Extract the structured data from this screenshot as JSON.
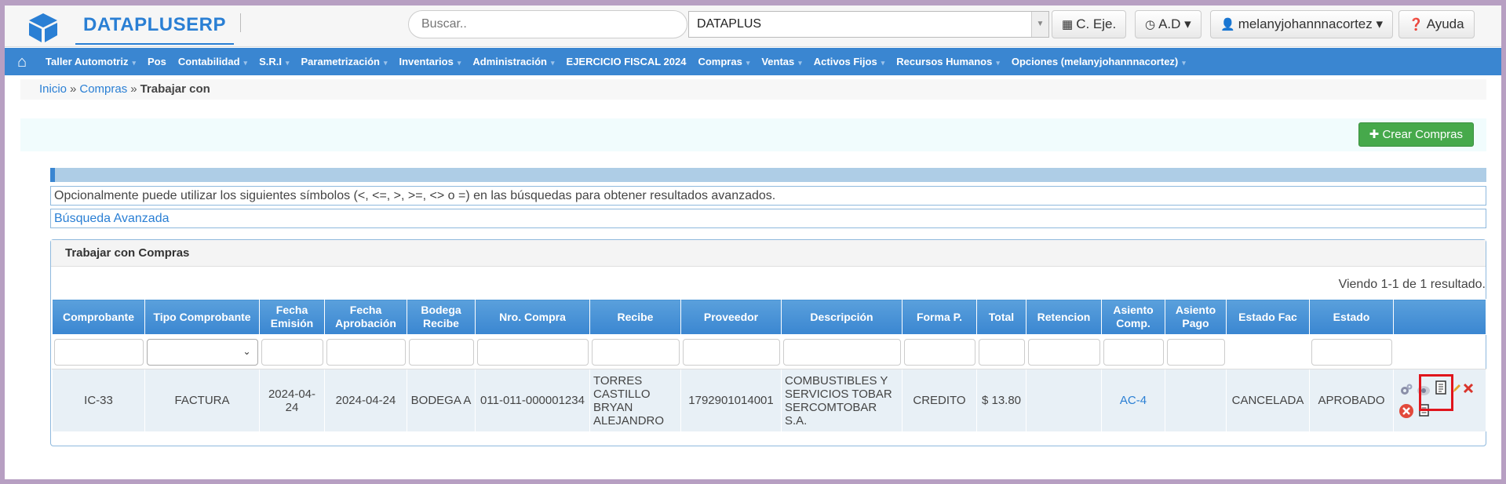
{
  "app": {
    "brand": "DATAPLUSERP",
    "search_placeholder": "Buscar..",
    "company": "DATAPLUS",
    "buttons": {
      "fiscal": "C. Eje.",
      "ad": "A.D",
      "user": "melanyjohannnacortez",
      "help": "Ayuda"
    }
  },
  "nav": {
    "items": [
      {
        "label": "Taller Automotriz",
        "caret": true
      },
      {
        "label": "Pos",
        "caret": false
      },
      {
        "label": "Contabilidad",
        "caret": true
      },
      {
        "label": "S.R.I",
        "caret": true
      },
      {
        "label": "Parametrización",
        "caret": true
      },
      {
        "label": "Inventarios",
        "caret": true
      },
      {
        "label": "Administración",
        "caret": true
      },
      {
        "label": "EJERCICIO FISCAL 2024",
        "caret": false
      },
      {
        "label": "Compras",
        "caret": true
      },
      {
        "label": "Ventas",
        "caret": true
      },
      {
        "label": "Activos Fijos",
        "caret": true
      },
      {
        "label": "Recursos Humanos",
        "caret": true
      },
      {
        "label": "Opciones (melanyjohannnacortez)",
        "caret": true
      }
    ]
  },
  "breadcrumb": {
    "home": "Inicio",
    "section": "Compras",
    "current": "Trabajar con",
    "separator": "»"
  },
  "actions": {
    "create": "Crear Compras"
  },
  "info": {
    "hint": "Opcionalmente puede utilizar los siguientes símbolos (<, <=, >, >=, <> o =) en las búsquedas para obtener resultados avanzados.",
    "advanced": "Búsqueda Avanzada"
  },
  "panel": {
    "title": "Trabajar con Compras",
    "summary": "Viendo 1-1 de 1 resultado."
  },
  "table": {
    "columns": [
      "Comprobante",
      "Tipo Comprobante",
      "Fecha Emisión",
      "Fecha Aprobación",
      "Bodega Recibe",
      "Nro. Compra",
      "Recibe",
      "Proveedor",
      "Descripción",
      "Forma P.",
      "Total",
      "Retencion",
      "Asiento Comp.",
      "Asiento Pago",
      "Estado Fac",
      "Estado",
      ""
    ],
    "rows": [
      {
        "comprobante": "IC-33",
        "tipo": "FACTURA",
        "fecha_emision": "2024-04-24",
        "fecha_aprobacion": "2024-04-24",
        "bodega": "BODEGA A",
        "nro_compra": "011-011-000001234",
        "recibe": "TORRES CASTILLO BRYAN ALEJANDRO",
        "proveedor": "1792901014001",
        "descripcion": "COMBUSTIBLES Y SERVICIOS TOBAR SERCOMTOBAR S.A.",
        "forma_pago": "CREDITO",
        "total": "$ 13.80",
        "retencion": "",
        "asiento_comp": "AC-4",
        "asiento_pago": "",
        "estado_fac": "CANCELADA",
        "estado": "APROBADO"
      }
    ]
  },
  "colors": {
    "brand": "#2a7fd4",
    "nav": "#3a86d1",
    "create": "#46a94b",
    "highlight": "#e0151c"
  }
}
